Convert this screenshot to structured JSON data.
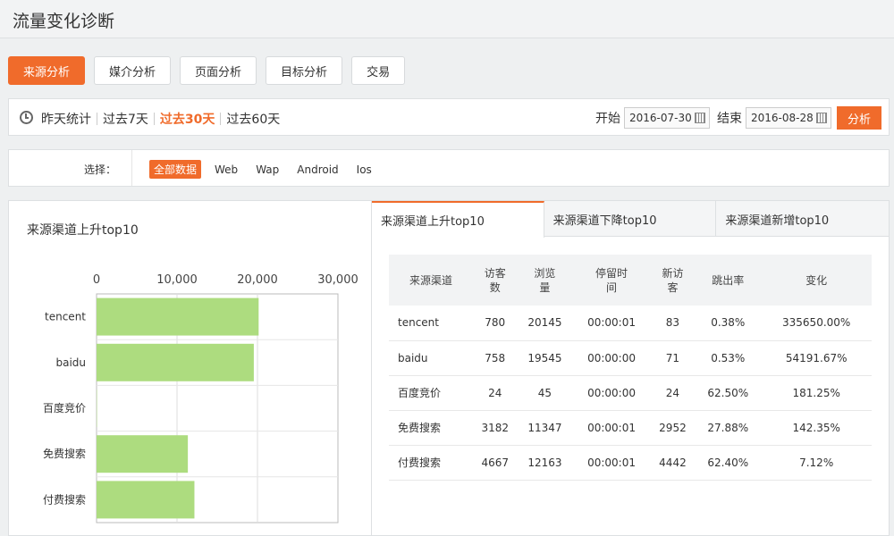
{
  "header": {
    "title": "流量变化诊断"
  },
  "main_tabs": [
    {
      "label": "来源分析",
      "active": true
    },
    {
      "label": "媒介分析",
      "active": false
    },
    {
      "label": "页面分析",
      "active": false
    },
    {
      "label": "目标分析",
      "active": false
    },
    {
      "label": "交易",
      "active": false
    }
  ],
  "periods": [
    {
      "label": "昨天统计",
      "active": false
    },
    {
      "label": "过去7天",
      "active": false
    },
    {
      "label": "过去30天",
      "active": true
    },
    {
      "label": "过去60天",
      "active": false
    }
  ],
  "date_range": {
    "start_label": "开始",
    "start_value": "2016-07-30",
    "end_label": "结束",
    "end_value": "2016-08-28",
    "analyze_label": "分析"
  },
  "selector": {
    "label": "选择：",
    "options": [
      {
        "label": "全部数据",
        "active": true
      },
      {
        "label": "Web",
        "active": false
      },
      {
        "label": "Wap",
        "active": false
      },
      {
        "label": "Android",
        "active": false
      },
      {
        "label": "Ios",
        "active": false
      }
    ]
  },
  "chart_data": {
    "type": "bar",
    "orientation": "horizontal",
    "title": "来源渠道上升top10",
    "categories": [
      "tencent",
      "baidu",
      "百度竞价",
      "免费搜索",
      "付费搜索"
    ],
    "values": [
      20145,
      19545,
      45,
      11347,
      12163
    ],
    "xlim": [
      0,
      30000
    ],
    "ticks": [
      "0",
      "10,000",
      "20,000",
      "30,000"
    ],
    "tick_values": [
      0,
      10000,
      20000,
      30000
    ],
    "axis_position": "top",
    "grid": true,
    "bar_color": "#addc7f"
  },
  "table_tabs": [
    {
      "label": "来源渠道上升top10",
      "active": true
    },
    {
      "label": "来源渠道下降top10",
      "active": false
    },
    {
      "label": "来源渠道新增top10",
      "active": false
    }
  ],
  "table": {
    "headers": [
      [
        "来源渠道"
      ],
      [
        "访客",
        "数"
      ],
      [
        "浏览",
        "量"
      ],
      [
        "停留时",
        "间"
      ],
      [
        "新访",
        "客"
      ],
      [
        "跳出率"
      ],
      [
        "变化"
      ]
    ],
    "rows": [
      [
        "tencent",
        "780",
        "20145",
        "00:00:01",
        "83",
        "0.38%",
        "335650.00%"
      ],
      [
        "baidu",
        "758",
        "19545",
        "00:00:00",
        "71",
        "0.53%",
        "54191.67%"
      ],
      [
        "百度竞价",
        "24",
        "45",
        "00:00:00",
        "24",
        "62.50%",
        "181.25%"
      ],
      [
        "免费搜索",
        "3182",
        "11347",
        "00:00:01",
        "2952",
        "27.88%",
        "142.35%"
      ],
      [
        "付费搜索",
        "4667",
        "12163",
        "00:00:01",
        "4442",
        "62.40%",
        "7.12%"
      ]
    ]
  },
  "colors": {
    "accent": "#f06b2b",
    "bar": "#addc7f"
  }
}
